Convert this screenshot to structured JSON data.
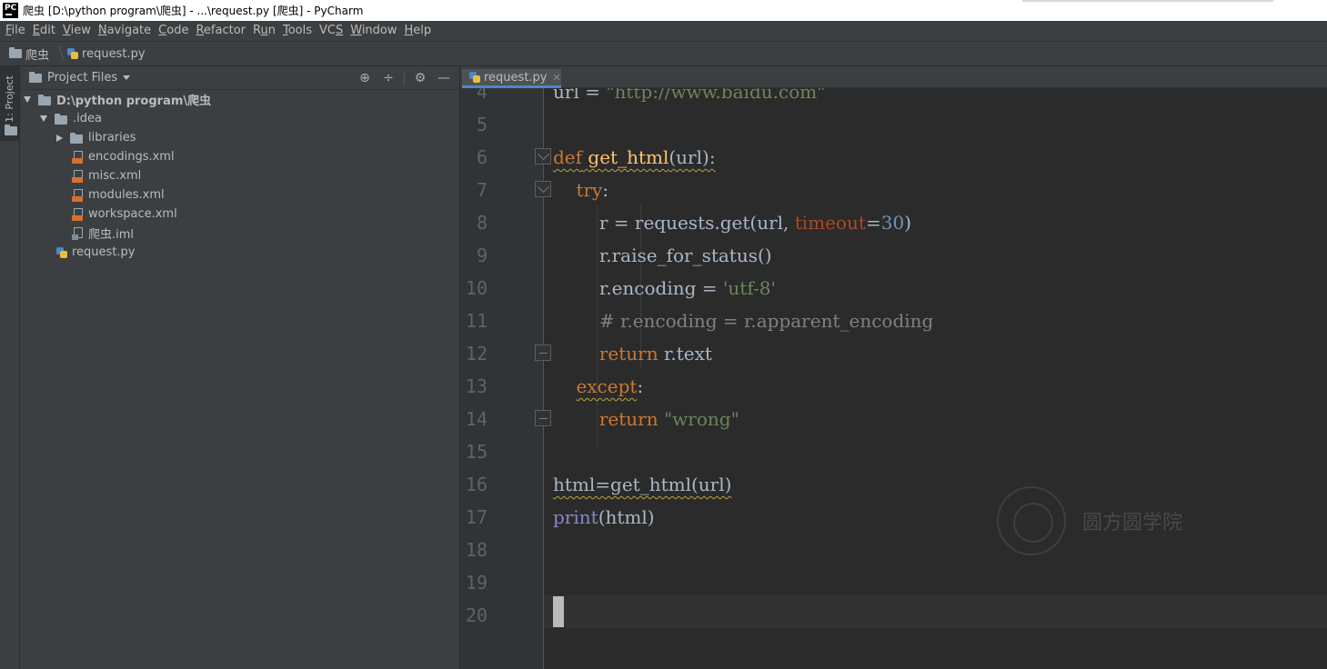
{
  "window": {
    "app_icon": "PC",
    "title": "爬虫 [D:\\python program\\爬虫] - ...\\request.py [爬虫] - PyCharm"
  },
  "menu": [
    {
      "label": "File",
      "mnemonic": "F"
    },
    {
      "label": "Edit",
      "mnemonic": "E"
    },
    {
      "label": "View",
      "mnemonic": "V"
    },
    {
      "label": "Navigate",
      "mnemonic": "N"
    },
    {
      "label": "Code",
      "mnemonic": "C"
    },
    {
      "label": "Refactor",
      "mnemonic": "R"
    },
    {
      "label": "Run",
      "mnemonic": "u"
    },
    {
      "label": "Tools",
      "mnemonic": "T"
    },
    {
      "label": "VCS",
      "mnemonic": "S"
    },
    {
      "label": "Window",
      "mnemonic": "W"
    },
    {
      "label": "Help",
      "mnemonic": "H"
    }
  ],
  "breadcrumb": {
    "project": "爬虫",
    "file": "request.py"
  },
  "toolstrip": {
    "project_tab": "1: Project"
  },
  "project_panel": {
    "title": "Project Files",
    "tools": [
      "locate-icon",
      "collapse-icon",
      "gear-icon",
      "minimize-icon"
    ],
    "tree": {
      "root": "D:\\python program\\爬虫",
      "idea": ".idea",
      "libraries": "libraries",
      "encodings": "encodings.xml",
      "misc": "misc.xml",
      "modules": "modules.xml",
      "workspace": "workspace.xml",
      "iml": "爬虫.iml",
      "request": "request.py"
    }
  },
  "editor": {
    "tab_label": "request.py",
    "line_numbers": [
      "4",
      "5",
      "6",
      "7",
      "8",
      "9",
      "10",
      "11",
      "12",
      "13",
      "14",
      "15",
      "16",
      "17",
      "18",
      "19",
      "20"
    ],
    "code": {
      "l4": {
        "var": "url = ",
        "str": "\"http://www.baidu.com\""
      },
      "l6": {
        "kw": "def",
        "name": "get_html",
        "args": "(url):"
      },
      "l7": {
        "kw": "try",
        "colon": ":"
      },
      "l8": {
        "a": "r = requests.get(url, ",
        "param": "timeout",
        "eq": "=",
        "num": "30",
        "close": ")"
      },
      "l9": {
        "text": "r.raise_for_status()"
      },
      "l10": {
        "a": "r.encoding = ",
        "str": "'utf-8'"
      },
      "l11": {
        "comment": "# r.encoding = r.apparent_encoding"
      },
      "l12": {
        "kw": "return",
        "rest": " r.text"
      },
      "l13": {
        "kw": "except",
        "colon": ":"
      },
      "l14": {
        "kw": "return",
        "str": "\"wrong\""
      },
      "l16": {
        "text": "html=get_html(url)"
      },
      "l17": {
        "builtin": "print",
        "rest": "(html)"
      }
    }
  },
  "watermark": {
    "text": "圆方圆学院"
  },
  "colors": {
    "editor_bg": "#2b2b2b",
    "panel_bg": "#3c3f41",
    "keyword": "#cc7832",
    "string": "#6a8759",
    "number": "#6897bb",
    "comment": "#808080",
    "accent": "#4a88c7"
  }
}
